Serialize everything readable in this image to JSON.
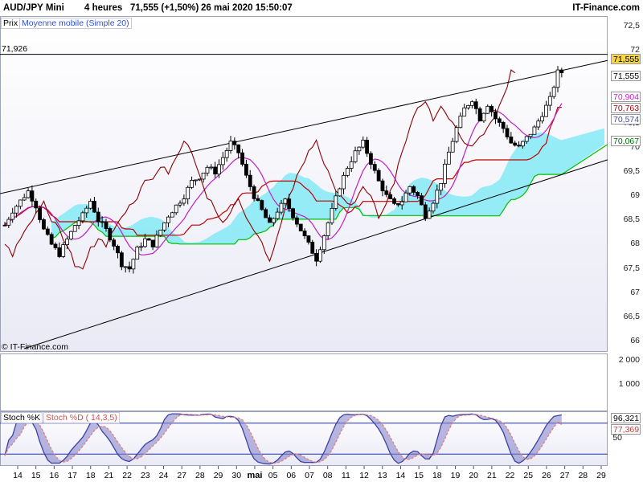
{
  "header": {
    "symbol": "AUD/JPY Mini",
    "timeframe": "4 heures",
    "quote": "71,555 (+1,50%)",
    "datetime": "26 mai 2020 15:50:07",
    "site": "IT-Finance.com"
  },
  "legend": {
    "prix": "Prix",
    "ma": "Moyenne mobile (Simple 20)",
    "stoch_k": "Stoch %K",
    "stoch_d": "Stoch %D ( 14,3,5)"
  },
  "watermark": "© IT-Finance.com",
  "price_panel": {
    "level_label": "71,926",
    "ytick_labels": [
      "72,5",
      "72",
      "71,5",
      "71",
      "70,5",
      "70",
      "69,5",
      "69",
      "68,5",
      "68",
      "67,5",
      "67",
      "66,5",
      "66"
    ],
    "pills": [
      {
        "label": "71,555",
        "color": "#f5d547"
      },
      {
        "label": "71,555",
        "color": "#ffffff"
      },
      {
        "label": "70,904",
        "color": "#d020d0"
      },
      {
        "label": "70,763",
        "color": "#b00000"
      },
      {
        "label": "70,574",
        "color": "#4050a0"
      },
      {
        "label": "70,067",
        "color": "#007000"
      }
    ]
  },
  "volume_panel": {
    "ytick_labels": [
      "2 000",
      "1 000"
    ]
  },
  "stoch_panel": {
    "value_labels": [
      "96,321",
      "77,369"
    ],
    "ytick_labels": [
      "50"
    ]
  },
  "xaxis": {
    "labels": [
      "14",
      "15",
      "16",
      "17",
      "18",
      "21",
      "22",
      "23",
      "24",
      "27",
      "28",
      "29",
      "30",
      "mai",
      "05",
      "06",
      "07",
      "08",
      "11",
      "12",
      "13",
      "14",
      "15",
      "18",
      "19",
      "20",
      "21",
      "22",
      "25",
      "26",
      "27",
      "28",
      "29"
    ]
  },
  "colors": {
    "candle_up": "#ffffff",
    "candle_down": "#000000",
    "ma_line": "#c020c0",
    "kijun": "#c00000",
    "chikou": "#8b0000",
    "ssb_line": "#00c000",
    "cloud_bull": "#7de8f5",
    "cloud_bear": "#80ee80",
    "stoch_k": "#4040a0",
    "stoch_d": "#e08080"
  },
  "chart_data": {
    "type": "candlestick",
    "instrument": "AUD/JPY Mini",
    "interval": "4 heures",
    "last": 71.555,
    "change_pct": 1.5,
    "horizontal_level": 71.926,
    "ylim": [
      65.8,
      72.7
    ],
    "x_labels": [
      "14",
      "15",
      "16",
      "17",
      "18",
      "21",
      "22",
      "23",
      "24",
      "27",
      "28",
      "29",
      "30",
      "mai",
      "05",
      "06",
      "07",
      "08",
      "11",
      "12",
      "13",
      "14",
      "15",
      "18",
      "19",
      "20",
      "21",
      "22",
      "25",
      "26",
      "27",
      "28",
      "29"
    ],
    "close_path": [
      68.4,
      68.7,
      68.9,
      69.1,
      68.8,
      68.3,
      68.0,
      67.8,
      68.1,
      68.4,
      68.6,
      68.9,
      68.5,
      68.3,
      68.0,
      67.6,
      67.5,
      67.9,
      68.1,
      68.0,
      68.3,
      68.6,
      68.8,
      69.0,
      69.3,
      69.4,
      69.6,
      69.5,
      69.8,
      70.1,
      69.9,
      69.4,
      69.0,
      68.7,
      68.4,
      68.7,
      68.9,
      68.6,
      68.3,
      68.0,
      67.7,
      68.2,
      68.7,
      69.2,
      69.6,
      69.9,
      70.1,
      69.7,
      69.3,
      69.0,
      68.8,
      68.9,
      69.2,
      69.0,
      68.6,
      68.9,
      69.3,
      69.9,
      70.4,
      70.8,
      71.0,
      70.6,
      70.9,
      70.6,
      70.4,
      70.1,
      70.0,
      70.2,
      70.4,
      70.7,
      71.0,
      71.555
    ],
    "stoch_k_last": 96.321,
    "stoch_d_last": 77.369
  }
}
